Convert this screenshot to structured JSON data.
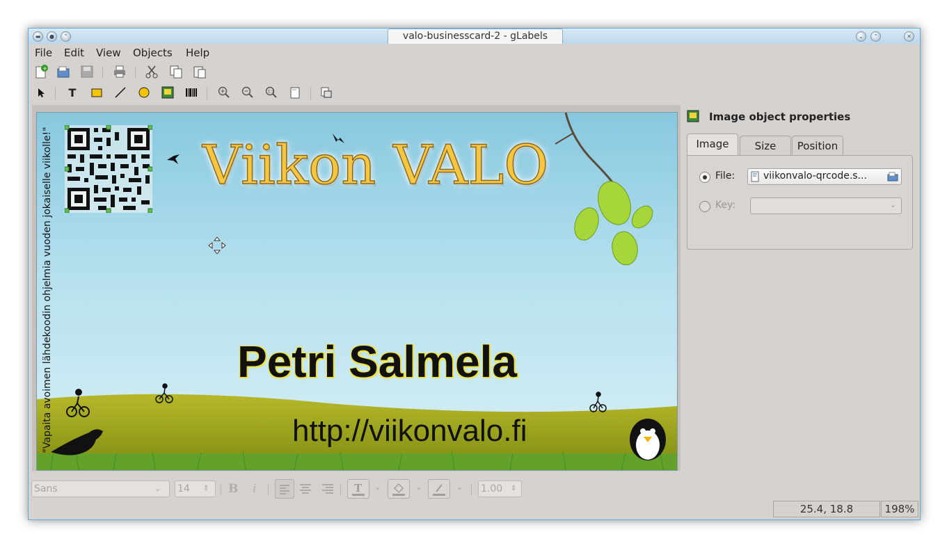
{
  "window": {
    "title": "valo-businesscard-2 - gLabels"
  },
  "menu": {
    "file": "File",
    "edit": "Edit",
    "view": "View",
    "objects": "Objects",
    "help": "Help"
  },
  "card": {
    "heading": "Viikon VALO",
    "name": "Petri Salmela",
    "url": "http://viikonvalo.fi",
    "vertical_text": "\"Vapaita avoimen lähdekoodin ohjelmia vuoden jokaiselle viikolle!\""
  },
  "properties": {
    "title": "Image object properties",
    "tabs": [
      "Image",
      "Size",
      "Position"
    ],
    "file_label": "File:",
    "file_value": "viikonvalo-qrcode.s...",
    "key_label": "Key:"
  },
  "format_bar": {
    "font": "Sans",
    "font_size": "14",
    "bold": "B",
    "italic": "i",
    "line_width": "1.00"
  },
  "status": {
    "coords": "25.4, 18.8",
    "zoom": "198%"
  },
  "colors": {
    "window_border": "#5fa9de",
    "sky_top": "#87c8df",
    "grass": "#9aa21a",
    "title_gold": "#f7c640"
  }
}
